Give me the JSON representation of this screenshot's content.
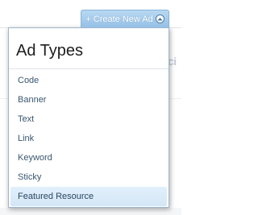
{
  "create_button": {
    "label": "+ Create New Ad",
    "icon": "chevron-up-circle-icon"
  },
  "background": {
    "fragment": "ci"
  },
  "menu": {
    "title": "Ad Types",
    "items": [
      {
        "label": "Code"
      },
      {
        "label": "Banner"
      },
      {
        "label": "Text"
      },
      {
        "label": "Link"
      },
      {
        "label": "Keyword"
      },
      {
        "label": "Sticky"
      },
      {
        "label": "Featured Resource",
        "highlighted": true
      }
    ]
  },
  "colors": {
    "button_bg": "#9cc6ea",
    "highlight_bg": "#dbeaf7",
    "item_text": "#3a5670",
    "title_text": "#1e1e1e"
  }
}
